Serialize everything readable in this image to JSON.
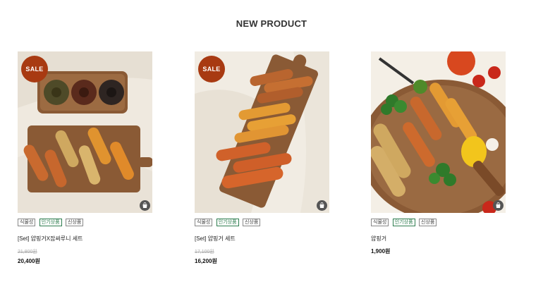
{
  "section": {
    "title": "NEW PRODUCT"
  },
  "products": [
    {
      "badge": "SALE",
      "tags": [
        "식물성",
        "인기상품",
        "신상품"
      ],
      "name": "[Set] 얍핑거X잡싸루니 세트",
      "original_price": "21,800원",
      "price": "20,400원",
      "cart_icon": "bag-icon"
    },
    {
      "badge": "SALE",
      "tags": [
        "식물성",
        "인기상품",
        "신상품"
      ],
      "name": "[Set] 얍핑거 세트",
      "original_price": "17,100원",
      "price": "16,200원",
      "cart_icon": "bag-icon"
    },
    {
      "badge": "",
      "tags": [
        "식물성",
        "인기상품",
        "신상품"
      ],
      "name": "얍핑거",
      "original_price": "",
      "price": "1,900원",
      "cart_icon": "bag-icon"
    }
  ],
  "colors": {
    "sale_badge": "#a83a12",
    "popular_tag": "#2e7d4f",
    "board": "#8a5a35"
  }
}
